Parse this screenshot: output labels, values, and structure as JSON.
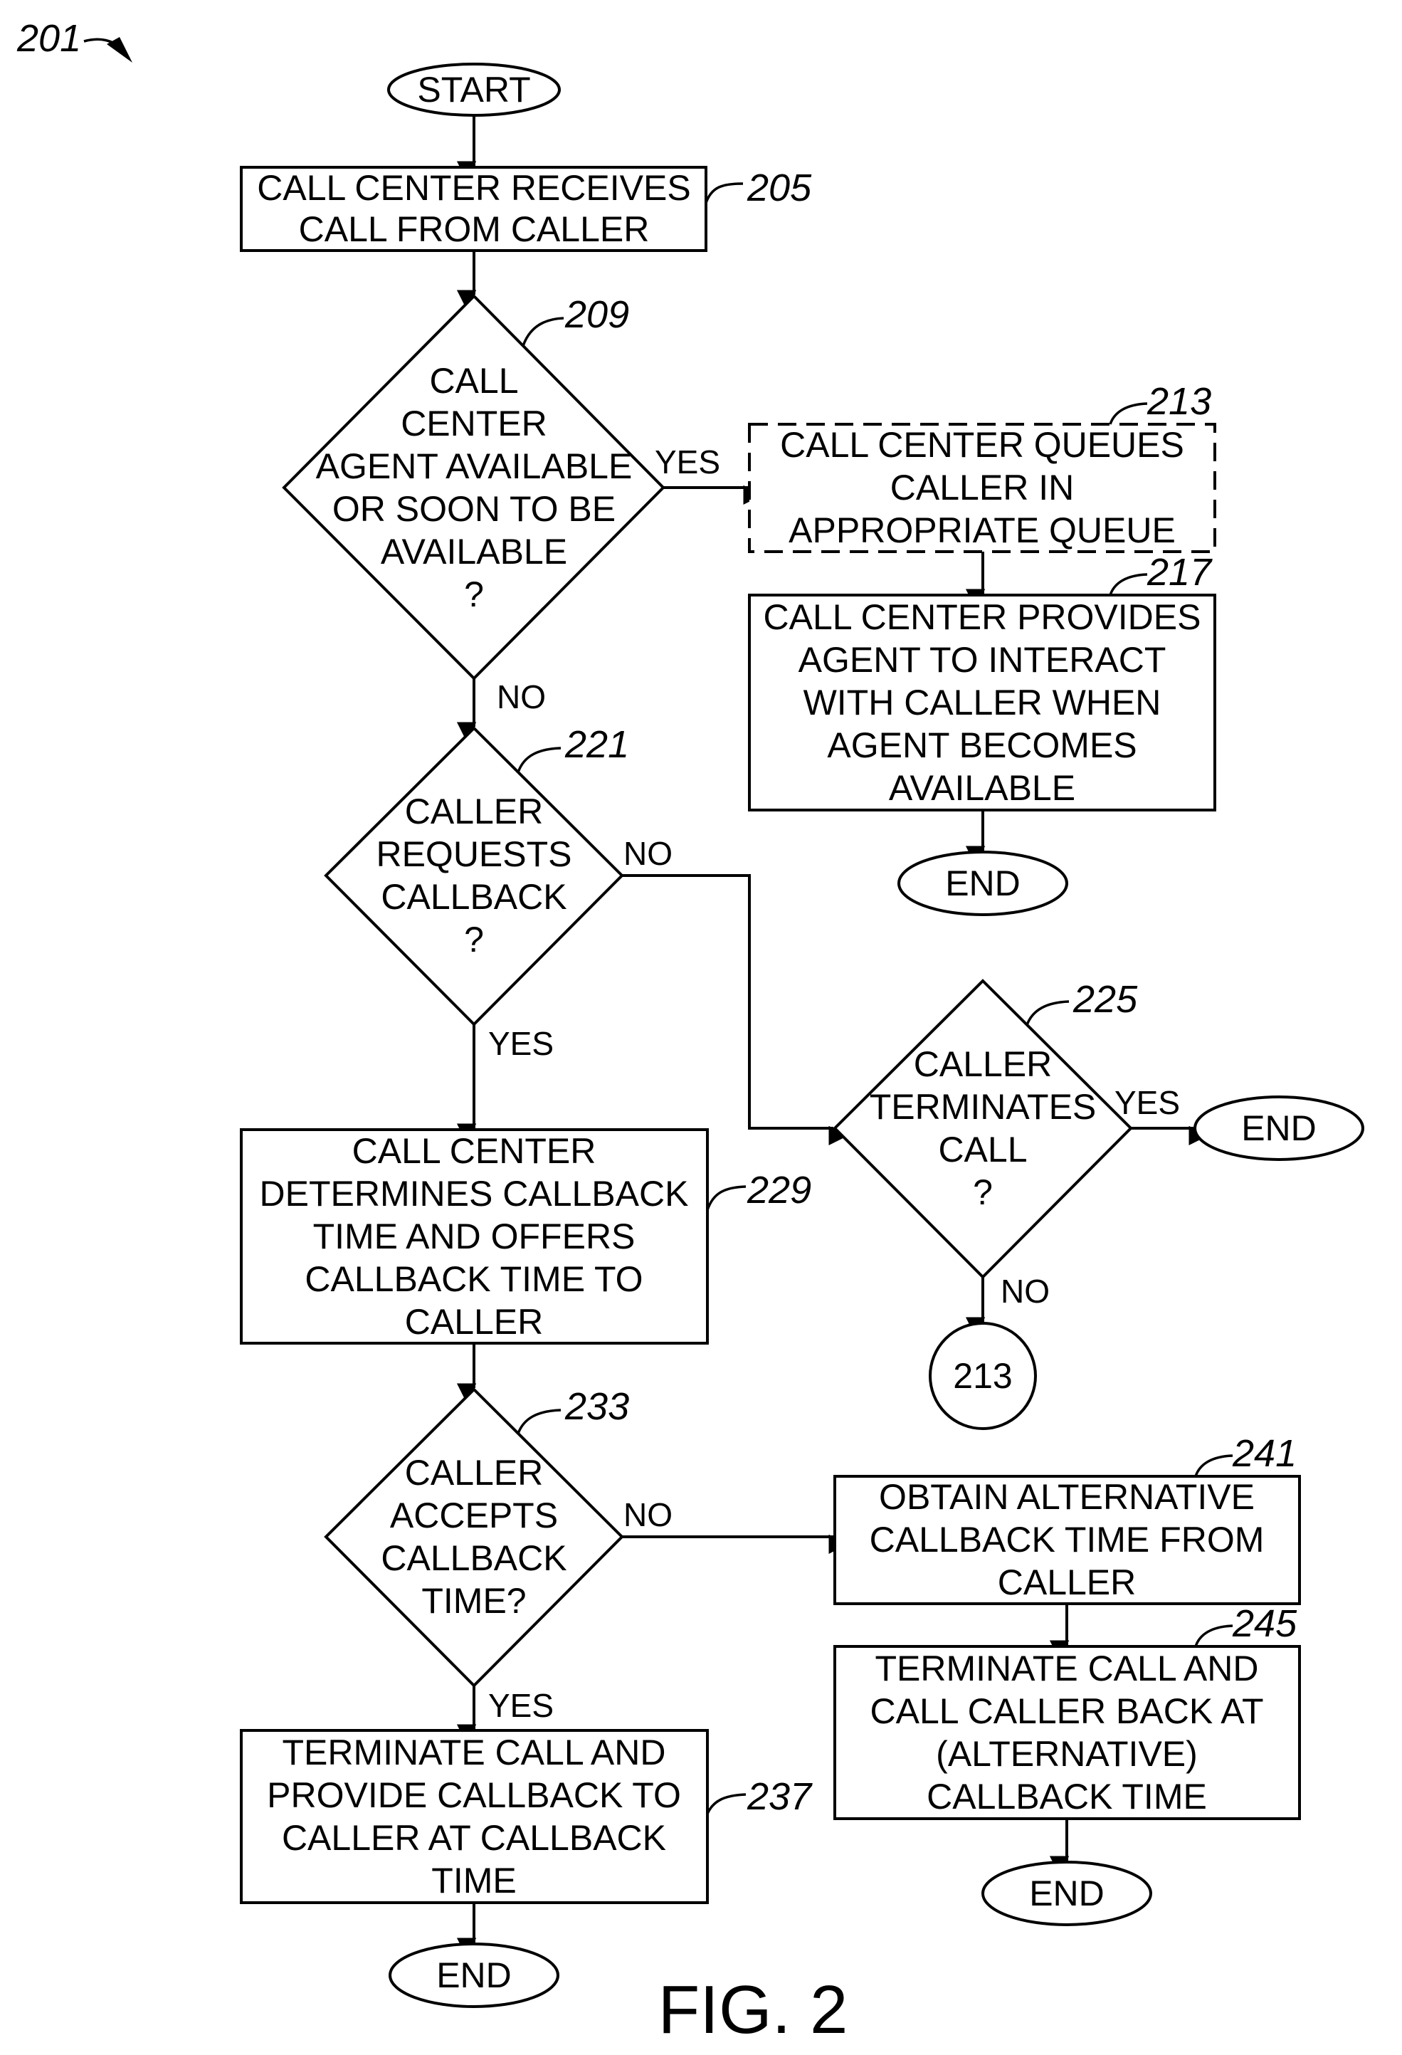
{
  "figure": {
    "ref": "201",
    "caption": "FIG. 2"
  },
  "nodes": {
    "start": {
      "type": "terminal",
      "lines": [
        "START"
      ]
    },
    "n205": {
      "type": "process",
      "ref": "205",
      "lines": [
        "CALL CENTER RECEIVES",
        "CALL FROM CALLER"
      ]
    },
    "n209": {
      "type": "decision",
      "ref": "209",
      "lines": [
        "CALL",
        "CENTER",
        "AGENT AVAILABLE",
        "OR SOON TO BE",
        "AVAILABLE",
        "?"
      ]
    },
    "n213": {
      "type": "process-optional",
      "ref": "213",
      "lines": [
        "CALL CENTER QUEUES",
        "CALLER IN",
        "APPROPRIATE QUEUE"
      ]
    },
    "n217": {
      "type": "process",
      "ref": "217",
      "lines": [
        "CALL CENTER PROVIDES",
        "AGENT TO INTERACT",
        "WITH CALLER WHEN",
        "AGENT BECOMES",
        "AVAILABLE"
      ]
    },
    "end217": {
      "type": "terminal",
      "lines": [
        "END"
      ]
    },
    "n221": {
      "type": "decision",
      "ref": "221",
      "lines": [
        "CALLER",
        "REQUESTS",
        "CALLBACK",
        "?"
      ]
    },
    "n225": {
      "type": "decision",
      "ref": "225",
      "lines": [
        "CALLER",
        "TERMINATES",
        "CALL",
        "?"
      ]
    },
    "end225": {
      "type": "terminal",
      "lines": [
        "END"
      ]
    },
    "conn213": {
      "type": "connector",
      "lines": [
        "213"
      ]
    },
    "n229": {
      "type": "process",
      "ref": "229",
      "lines": [
        "CALL CENTER",
        "DETERMINES CALLBACK",
        "TIME AND OFFERS",
        "CALLBACK TIME TO",
        "CALLER"
      ]
    },
    "n233": {
      "type": "decision",
      "ref": "233",
      "lines": [
        "CALLER",
        "ACCEPTS",
        "CALLBACK",
        "TIME?"
      ]
    },
    "n237": {
      "type": "process",
      "ref": "237",
      "lines": [
        "TERMINATE CALL AND",
        "PROVIDE CALLBACK TO",
        "CALLER AT CALLBACK",
        "TIME"
      ]
    },
    "end237": {
      "type": "terminal",
      "lines": [
        "END"
      ]
    },
    "n241": {
      "type": "process",
      "ref": "241",
      "lines": [
        "OBTAIN ALTERNATIVE",
        "CALLBACK TIME FROM",
        "CALLER"
      ]
    },
    "n245": {
      "type": "process",
      "ref": "245",
      "lines": [
        "TERMINATE CALL AND",
        "CALL CALLER BACK AT",
        "(ALTERNATIVE)",
        "CALLBACK TIME"
      ]
    },
    "end245": {
      "type": "terminal",
      "lines": [
        "END"
      ]
    }
  },
  "edges": [
    {
      "from": "start",
      "to": "n205",
      "label": ""
    },
    {
      "from": "n205",
      "to": "n209",
      "label": ""
    },
    {
      "from": "n209",
      "to": "n213",
      "label": "YES"
    },
    {
      "from": "n209",
      "to": "n221",
      "label": "NO"
    },
    {
      "from": "n213",
      "to": "n217",
      "label": ""
    },
    {
      "from": "n217",
      "to": "end217",
      "label": ""
    },
    {
      "from": "n221",
      "to": "n225",
      "label": "NO"
    },
    {
      "from": "n221",
      "to": "n229",
      "label": "YES"
    },
    {
      "from": "n225",
      "to": "end225",
      "label": "YES"
    },
    {
      "from": "n225",
      "to": "conn213",
      "label": "NO"
    },
    {
      "from": "n229",
      "to": "n233",
      "label": ""
    },
    {
      "from": "n233",
      "to": "n241",
      "label": "NO"
    },
    {
      "from": "n233",
      "to": "n237",
      "label": "YES"
    },
    {
      "from": "n237",
      "to": "end237",
      "label": ""
    },
    {
      "from": "n241",
      "to": "n245",
      "label": ""
    },
    {
      "from": "n245",
      "to": "end245",
      "label": ""
    }
  ]
}
